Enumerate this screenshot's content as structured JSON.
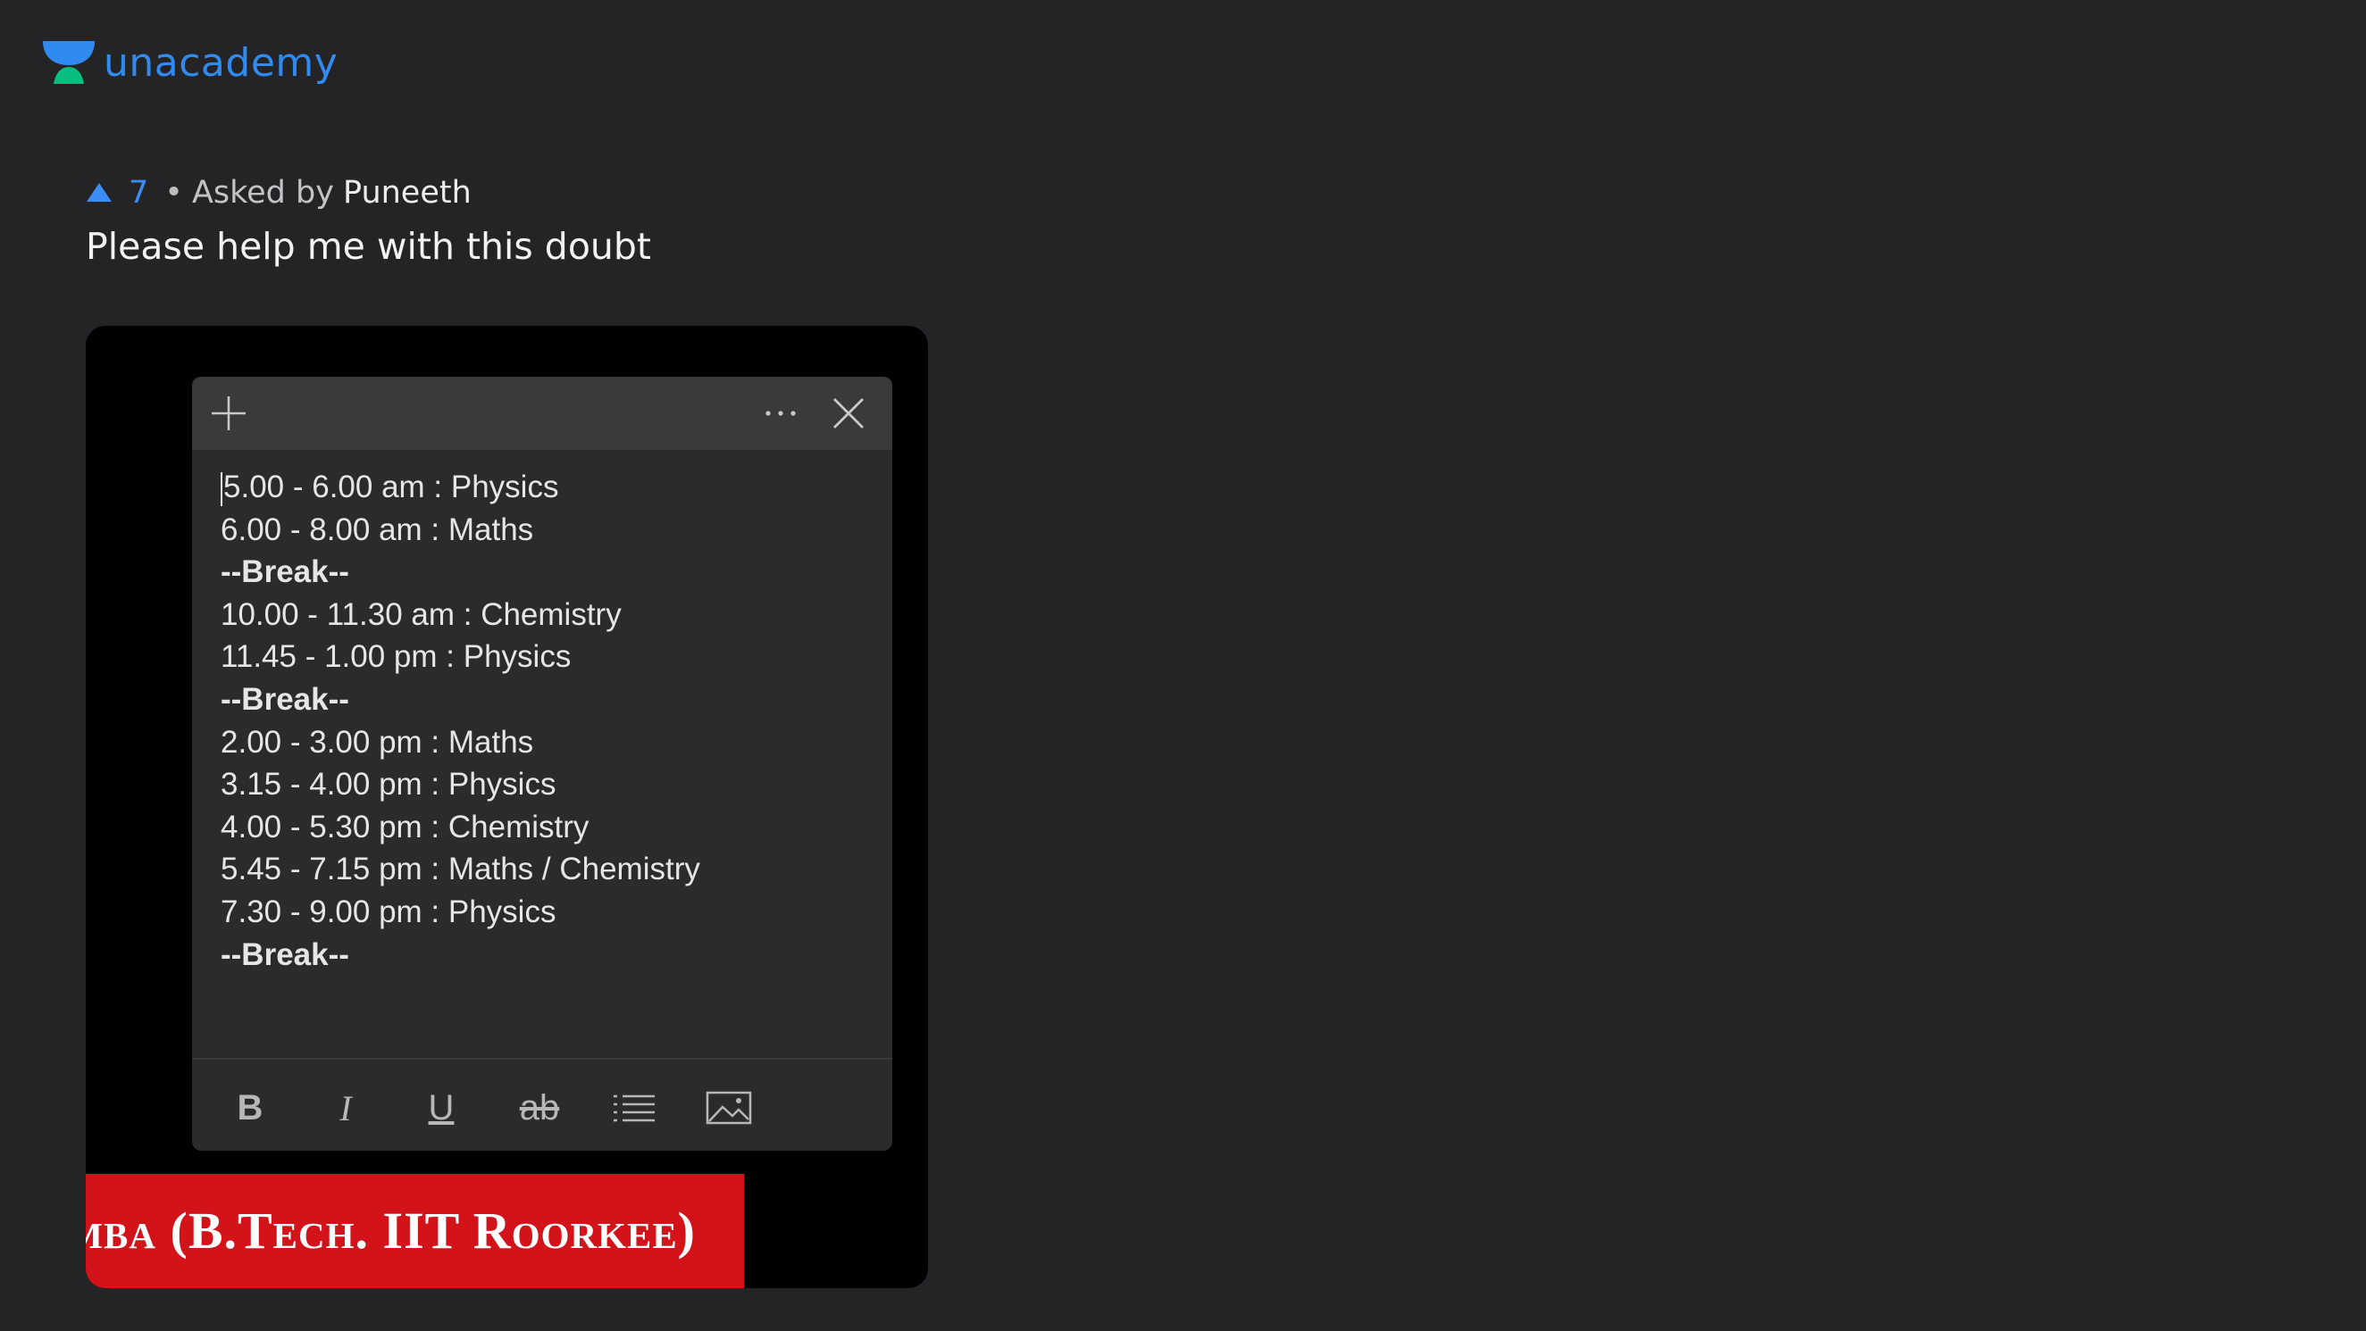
{
  "brand": {
    "name": "unacademy",
    "logo_icon": "unacademy-logo-icon",
    "accent": "#2f8bf0",
    "logo_green": "#08bd80"
  },
  "question": {
    "upvotes": "7",
    "separator": "•",
    "asked_by_label": "Asked by",
    "asker_name": "Puneeth",
    "text": "Please help me with this doubt"
  },
  "attachment": {
    "note": {
      "titlebar": {
        "new_note_icon": "plus-icon",
        "more_icon": "more-options-icon",
        "close_icon": "close-icon"
      },
      "lines": [
        {
          "text": "5.00 - 6.00 am : Physics",
          "bold": false
        },
        {
          "text": "6.00 - 8.00 am : Maths",
          "bold": false
        },
        {
          "text": "--Break--",
          "bold": true
        },
        {
          "text": "10.00 - 11.30 am : Chemistry",
          "bold": false
        },
        {
          "text": "11.45 - 1.00 pm : Physics",
          "bold": false
        },
        {
          "text": "--Break--",
          "bold": true
        },
        {
          "text": "2.00 - 3.00 pm : Maths",
          "bold": false
        },
        {
          "text": "3.15 - 4.00 pm : Physics",
          "bold": false
        },
        {
          "text": "4.00 - 5.30 pm : Chemistry",
          "bold": false
        },
        {
          "text": "5.45 - 7.15 pm : Maths / Chemistry",
          "bold": false
        },
        {
          "text": "7.30 - 9.00 pm : Physics",
          "bold": false
        },
        {
          "text": "--Break--",
          "bold": true
        }
      ],
      "format_bar": {
        "bold_label": "B",
        "italic_label": "I",
        "underline_label": "U",
        "strikethrough_label": "ab",
        "list_icon": "bulleted-list-icon",
        "image_icon": "insert-image-icon"
      }
    },
    "banner_text": "oomba (B.Tech. IIT Roorkee)"
  }
}
